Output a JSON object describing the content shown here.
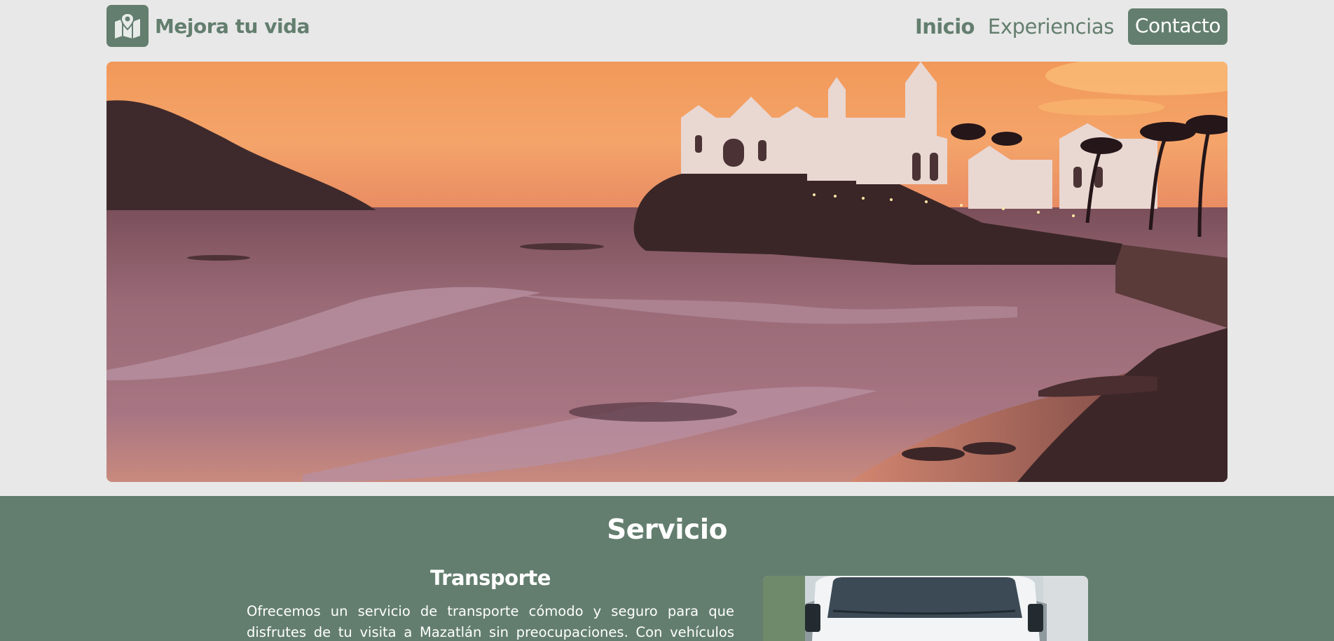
{
  "header": {
    "brand_name": "Mejora tu vida",
    "logo_icon": "map-pin-icon",
    "nav": {
      "inicio": "Inicio",
      "experiencias": "Experiencias",
      "contacto": "Contacto"
    }
  },
  "hero": {
    "image": "sunset-beach-coast-photo"
  },
  "servicio": {
    "title": "Servicio",
    "card": {
      "title": "Transporte",
      "text": "Ofrecemos un servicio de transporte cómodo y seguro para que disfrutes de tu visita a Mazatlán sin preocupaciones. Con vehículos modernos y",
      "image": "white-van-photo"
    }
  },
  "colors": {
    "accent": "#637e6e",
    "background": "#e8e8e8",
    "text_on_accent": "#ffffff"
  }
}
